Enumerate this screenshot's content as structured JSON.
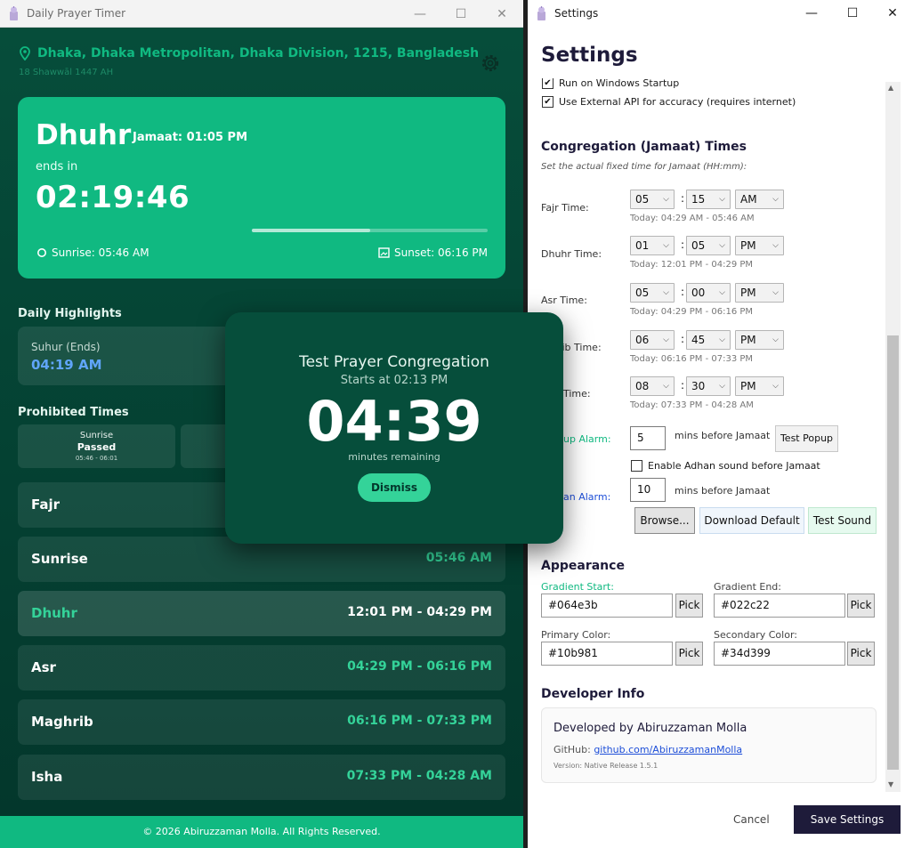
{
  "left_window": {
    "title": "Daily Prayer Timer",
    "location": "Dhaka, Dhaka Metropolitan, Dhaka Division, 1215, Bangladesh",
    "hijri_date": "18 Shawwāl 1447 AH",
    "current": {
      "prayer": "Dhuhr",
      "jamaat": "Jamaat: 01:05 PM",
      "ends_label": "ends in",
      "countdown": "02:19:46",
      "progress": 0.5,
      "sunrise": "Sunrise: 05:46 AM",
      "sunset": "Sunset: 06:16 PM"
    },
    "highlights": {
      "heading": "Daily Highlights",
      "cards": [
        {
          "label": "Suhur (Ends)",
          "value": "04:19 AM"
        }
      ]
    },
    "prohibited": {
      "heading": "Prohibited Times",
      "cards": [
        {
          "name": "Sunrise",
          "status": "Passed",
          "range": "05:46 - 06:01"
        }
      ]
    },
    "prayers": [
      {
        "name": "Fajr",
        "time": ""
      },
      {
        "name": "Sunrise",
        "time": "05:46 AM"
      },
      {
        "name": "Dhuhr",
        "time": "12:01 PM - 04:29 PM"
      },
      {
        "name": "Asr",
        "time": "04:29 PM - 06:16 PM"
      },
      {
        "name": "Maghrib",
        "time": "06:16 PM - 07:33 PM"
      },
      {
        "name": "Isha",
        "time": "07:33 PM - 04:28 AM"
      }
    ],
    "footer": "© 2026 Abiruzzaman Molla. All Rights Reserved."
  },
  "popup": {
    "title": "Test Prayer Congregation",
    "subtitle": "Starts at 02:13 PM",
    "countdown": "04:39",
    "remaining_label": "minutes remaining",
    "dismiss": "Dismiss"
  },
  "settings": {
    "window_title": "Settings",
    "heading": "Settings",
    "checkboxes": [
      {
        "label": "Run on Windows Startup",
        "checked": true
      },
      {
        "label": "Use External API for accuracy (requires internet)",
        "checked": true
      }
    ],
    "jamaat": {
      "heading": "Congregation (Jamaat) Times",
      "hint": "Set the actual fixed time for Jamaat (HH:mm):",
      "rows": [
        {
          "label": "Fajr Time:",
          "hour": "05",
          "minute": "15",
          "ampm": "AM",
          "range": "Today: 04:29 AM - 05:46 AM"
        },
        {
          "label": "Dhuhr Time:",
          "hour": "01",
          "minute": "05",
          "ampm": "PM",
          "range": "Today: 12:01 PM - 04:29 PM"
        },
        {
          "label": "Asr Time:",
          "hour": "05",
          "minute": "00",
          "ampm": "PM",
          "range": "Today: 04:29 PM - 06:16 PM"
        },
        {
          "label": "hrib Time:",
          "hour": "06",
          "minute": "45",
          "ampm": "PM",
          "range": "Today: 06:16 PM - 07:33 PM"
        },
        {
          "label": "Time:",
          "hour": "08",
          "minute": "30",
          "ampm": "PM",
          "range": "Today: 07:33 PM - 04:28 AM"
        }
      ]
    },
    "popup_alarm": {
      "label": "up Alarm:",
      "value": "5",
      "suffix": "mins before Jamaat",
      "button": "Test Popup",
      "color": "#10b981"
    },
    "adhan_checkbox": {
      "label": "Enable Adhan sound before Jamaat",
      "checked": false
    },
    "adhan_alarm": {
      "label": "an Alarm:",
      "value": "10",
      "suffix": "mins before Jamaat",
      "color": "#1d4ed8"
    },
    "sound_buttons": {
      "browse": "Browse...",
      "download": "Download Default",
      "test": "Test Sound"
    },
    "appearance": {
      "heading": "Appearance",
      "gradient_start_label": "Gradient Start:",
      "gradient_start": "#064e3b",
      "gradient_end_label": "Gradient End:",
      "gradient_end": "#022c22",
      "primary_label": "Primary Color:",
      "primary": "#10b981",
      "secondary_label": "Secondary Color:",
      "secondary": "#34d399",
      "pick": "Pick"
    },
    "developer": {
      "heading": "Developer Info",
      "by": "Developed by Abiruzzaman Molla",
      "github_label": "GitHub:",
      "github_link": "github.com/AbiruzzamanMolla",
      "version": "Version: Native Release 1.5.1"
    },
    "cancel": "Cancel",
    "save": "Save Settings"
  }
}
